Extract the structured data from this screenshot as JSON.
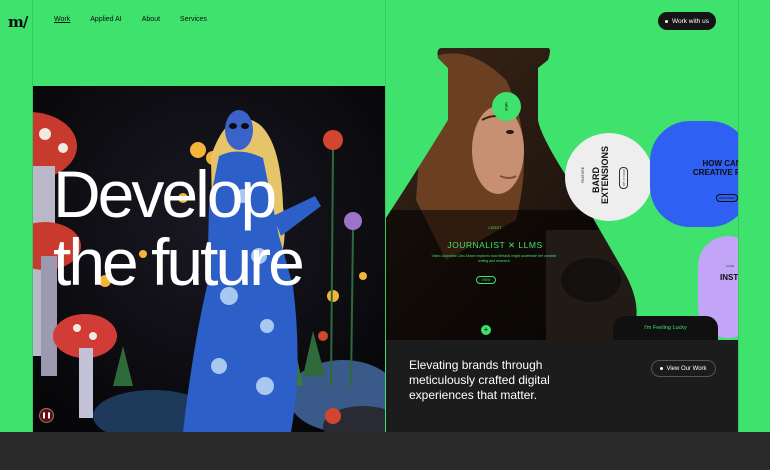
{
  "header": {
    "logo": "m/",
    "nav": [
      {
        "label": "Work",
        "active": true
      },
      {
        "label": "Applied AI",
        "active": false
      },
      {
        "label": "About",
        "active": false
      },
      {
        "label": "Services",
        "active": false
      }
    ],
    "cta_label": "Work with us"
  },
  "hero": {
    "title_line1": "Develop",
    "title_line2": "the future",
    "pause_icon": "pause-icon"
  },
  "flask": {
    "badge": "NEW",
    "latest_label": "LATEST",
    "headline": "JOURNALIST ✕ LLMS",
    "description": "Video Journalist Cleo Abram explores how Meta/AI might accelerate her creative writing and research",
    "view_label": "VIEW",
    "plus_label": "+"
  },
  "cards": {
    "feature_label": "FEATURE",
    "bard_title": "BARD EXTENSIONS",
    "try_label": "TRY IT NOW",
    "blue_question": "HOW CAN CREATIVE PAR",
    "blue_button": "DISCOVER",
    "purple_small": "CASE",
    "purple_title": "INST PLA",
    "lucky_label": "I'm Feeling Lucky"
  },
  "bottom": {
    "tagline": "Elevating brands through meticulously crafted digital experiences that matter.",
    "view_work_label": "View Our Work"
  },
  "colors": {
    "brand_green": "#3ee26d",
    "dark": "#1c1c1c",
    "blue": "#2f5ff3",
    "purple": "#c3a5f7"
  }
}
